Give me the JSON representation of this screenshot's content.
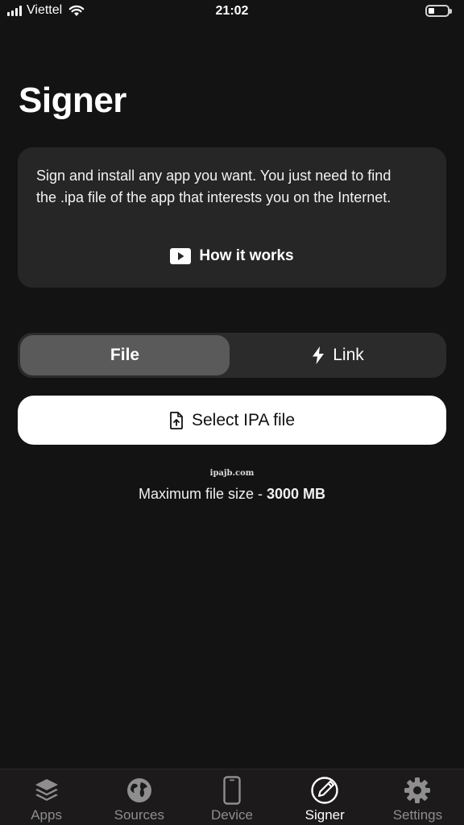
{
  "status_bar": {
    "carrier": "Viettel",
    "time": "21:02"
  },
  "page": {
    "title": "Signer"
  },
  "info_card": {
    "text": "Sign and install any app you want. You just need to find the .ipa file of the app that interests you on the Internet.",
    "how_it_works_label": "How it works",
    "icon": "play-video-icon"
  },
  "segmented": {
    "options": [
      {
        "label": "File",
        "selected": true
      },
      {
        "label": "Link",
        "selected": false,
        "icon": "bolt-icon"
      }
    ]
  },
  "select_button": {
    "label": "Select IPA file",
    "icon": "file-upload-icon"
  },
  "watermark": "ipajb.com",
  "max_size": {
    "prefix": "Maximum file size - ",
    "value": "3000 MB"
  },
  "tab_bar": {
    "items": [
      {
        "label": "Apps",
        "icon": "layers-icon",
        "active": false
      },
      {
        "label": "Sources",
        "icon": "globe-icon",
        "active": false
      },
      {
        "label": "Device",
        "icon": "phone-icon",
        "active": false
      },
      {
        "label": "Signer",
        "icon": "signer-pen-icon",
        "active": true
      },
      {
        "label": "Settings",
        "icon": "gear-icon",
        "active": false
      }
    ]
  },
  "colors": {
    "background": "#131313",
    "card": "#262626",
    "segment_track": "#2b2b2b",
    "segment_selected": "#5a5a5a",
    "tab_inactive": "#8e8e8e",
    "tab_active": "#ffffff"
  }
}
